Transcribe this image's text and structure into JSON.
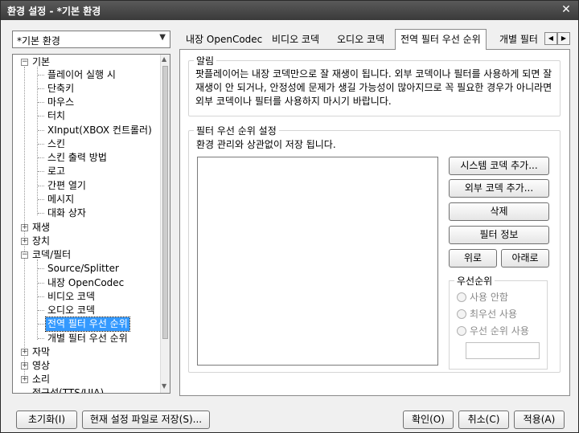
{
  "window": {
    "title": "환경 설정 - *기본 환경"
  },
  "preset": {
    "selected": "*기본 환경"
  },
  "tree": {
    "basic": "기본",
    "basic_items": [
      "플레이어 실행 시",
      "단축키",
      "마우스",
      "터치",
      "XInput(XBOX 컨트롤러)",
      "스킨",
      "스킨 출력 방법",
      "로고",
      "간편 열기",
      "메시지",
      "대화 상자"
    ],
    "playback": "재생",
    "device": "장치",
    "codec": "코덱/필터",
    "codec_items": [
      "Source/Splitter",
      "내장 OpenCodec",
      "비디오 코덱",
      "오디오 코덱",
      "전역 필터 우선 순위",
      "개별 필터 우선 순위"
    ],
    "subtitle": "자막",
    "video": "영상",
    "audio": "소리",
    "cutoff": "접근성(TTS/UIA)"
  },
  "tabs": [
    "내장 OpenCodec",
    "비디오 코덱",
    "오디오 코덱",
    "전역 필터 우선 순위",
    "개별 필터"
  ],
  "notice": {
    "legend": "알림",
    "text": "팟플레이어는 내장 코덱만으로 잘 재생이 됩니다. 외부 코덱이나 필터를 사용하게 되면 잘 재생이 안 되거나, 안정성에 문제가 생길 가능성이 많아지므로 꼭 필요한 경우가 아니라면 외부 코덱이나 필터를 사용하지 마시기 바랍니다."
  },
  "filter": {
    "legend": "필터 우선 순위 설정",
    "desc": "환경 관리와 상관없이 저장 됩니다.",
    "add_system": "시스템 코덱 추가...",
    "add_external": "외부 코덱 추가...",
    "delete": "삭제",
    "info": "필터 정보",
    "up": "위로",
    "down": "아래로"
  },
  "priority": {
    "legend": "우선순위",
    "none": "사용 안함",
    "highest": "최우선 사용",
    "order": "우선 순위 사용"
  },
  "footer": {
    "reset": "초기화(I)",
    "save": "현재 설정 파일로 저장(S)...",
    "ok": "확인(O)",
    "cancel": "취소(C)",
    "apply": "적용(A)"
  }
}
